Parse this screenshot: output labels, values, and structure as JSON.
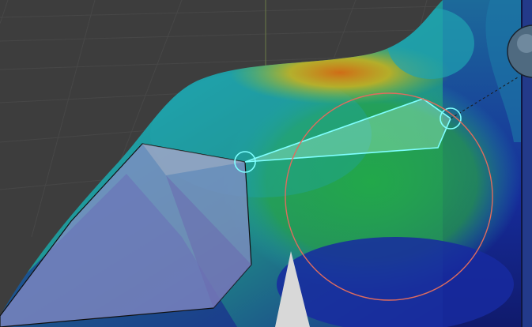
{
  "viewport": {
    "mode": "weight-paint-sculpt",
    "background_color": "#3d3d3d",
    "grid_color": "#474747",
    "y_axis_color": "#6a7a46"
  },
  "heatmap": {
    "colors": [
      "#1a1d8e",
      "#1e5bd0",
      "#1fa3b0",
      "#22a84a",
      "#84c22c",
      "#d9b410",
      "#d86a10"
    ],
    "hot_region": "upper-ridge"
  },
  "brush": {
    "cursor_color": "#e06c5e",
    "falloff_shape": "circle"
  },
  "selection": {
    "outline_color": "#7fffff",
    "handle_color": "#7fffff",
    "fill_color": "#c8ffe8"
  },
  "icons": {
    "brush_cursor": "brush-circle-icon",
    "handle": "handle-ring-icon",
    "gizmo": "sphere-gizmo-icon"
  }
}
